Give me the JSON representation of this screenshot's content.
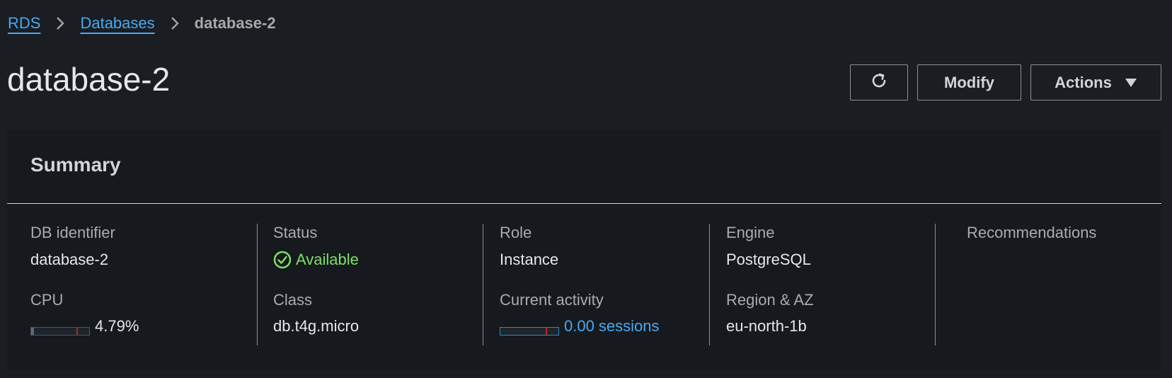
{
  "breadcrumb": {
    "items": [
      {
        "label": "RDS"
      },
      {
        "label": "Databases"
      },
      {
        "label": "database-2"
      }
    ]
  },
  "page": {
    "title": "database-2"
  },
  "toolbar": {
    "refresh_icon": "refresh-icon",
    "modify_label": "Modify",
    "actions_label": "Actions"
  },
  "summary": {
    "title": "Summary",
    "db_identifier": {
      "label": "DB identifier",
      "value": "database-2"
    },
    "cpu": {
      "label": "CPU",
      "value": "4.79%",
      "fraction": 0.0479
    },
    "status": {
      "label": "Status",
      "value": "Available",
      "color": "#7ee066"
    },
    "class": {
      "label": "Class",
      "value": "db.t4g.micro"
    },
    "role": {
      "label": "Role",
      "value": "Instance"
    },
    "current_activity": {
      "label": "Current activity",
      "value": "0.00 sessions",
      "fraction": 0.0
    },
    "engine": {
      "label": "Engine",
      "value": "PostgreSQL"
    },
    "region_az": {
      "label": "Region & AZ",
      "value": "eu-north-1b"
    },
    "recommendations": {
      "label": "Recommendations"
    }
  },
  "colors": {
    "background": "#1a1d21",
    "panel": "#16191d",
    "link": "#48a9f5",
    "available": "#7ee066"
  }
}
